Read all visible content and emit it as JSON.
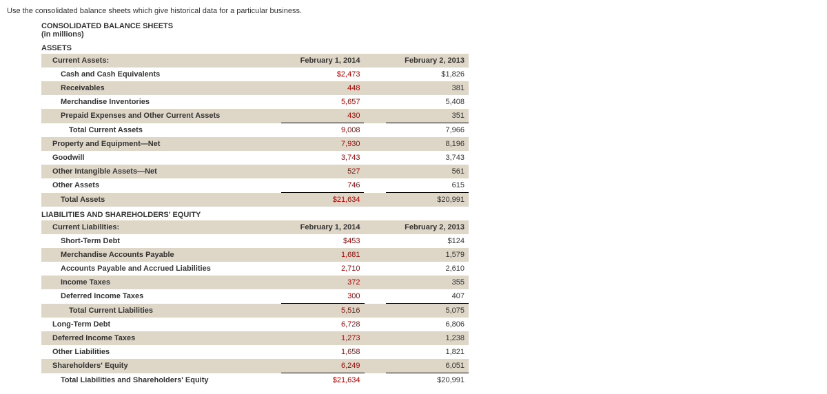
{
  "intro": "Use the consolidated balance sheets which give historical data for a particular business.",
  "title": "CONSOLIDATED BALANCE SHEETS",
  "subtitle": "(in millions)",
  "sections": {
    "assets": {
      "heading": "ASSETS",
      "header": {
        "label": "Current Assets:",
        "c1": "February 1, 2014",
        "c2": "February 2, 2013"
      },
      "rows": [
        {
          "label": "Cash and Cash Equivalents",
          "c1": "$2,473",
          "c2": "$1,826",
          "shade": false
        },
        {
          "label": "Receivables",
          "c1": "448",
          "c2": "381",
          "shade": true
        },
        {
          "label": "Merchandise Inventories",
          "c1": "5,657",
          "c2": "5,408",
          "shade": false
        },
        {
          "label": "Prepaid Expenses and Other Current Assets",
          "c1": "430",
          "c2": "351",
          "shade": true
        }
      ],
      "tca": {
        "label": "Total Current Assets",
        "c1": "9,008",
        "c2": "7,966"
      },
      "rows2": [
        {
          "label": "Property and Equipment—Net",
          "c1": "7,930",
          "c2": "8,196",
          "shade": true
        },
        {
          "label": "Goodwill",
          "c1": "3,743",
          "c2": "3,743",
          "shade": false
        },
        {
          "label": "Other Intangible Assets—Net",
          "c1": "527",
          "c2": "561",
          "shade": true
        },
        {
          "label": "Other Assets",
          "c1": "746",
          "c2": "615",
          "shade": false
        }
      ],
      "total": {
        "label": "Total Assets",
        "c1": "$21,634",
        "c2": "$20,991"
      }
    },
    "liab": {
      "heading": "LIABILITIES AND SHAREHOLDERS' EQUITY",
      "header": {
        "label": "Current Liabilities:",
        "c1": "February 1, 2014",
        "c2": "February 2, 2013"
      },
      "rows": [
        {
          "label": "Short-Term Debt",
          "c1": "$453",
          "c2": "$124",
          "shade": false
        },
        {
          "label": "Merchandise Accounts Payable",
          "c1": "1,681",
          "c2": "1,579",
          "shade": true
        },
        {
          "label": "Accounts Payable and Accrued Liabilities",
          "c1": "2,710",
          "c2": "2,610",
          "shade": false
        },
        {
          "label": "Income Taxes",
          "c1": "372",
          "c2": "355",
          "shade": true
        },
        {
          "label": "Deferred Income Taxes",
          "c1": "300",
          "c2": "407",
          "shade": false
        }
      ],
      "tcl": {
        "label": "Total Current Liabilities",
        "c1": "5,516",
        "c2": "5,075"
      },
      "rows2": [
        {
          "label": "Long-Term Debt",
          "c1": "6,728",
          "c2": "6,806",
          "shade": false
        },
        {
          "label": "Deferred Income Taxes",
          "c1": "1,273",
          "c2": "1,238",
          "shade": true
        },
        {
          "label": "Other Liabilities",
          "c1": "1,658",
          "c2": "1,821",
          "shade": false
        },
        {
          "label": "Shareholders' Equity",
          "c1": "6,249",
          "c2": "6,051",
          "shade": true
        }
      ],
      "total": {
        "label": "Total Liabilities and Shareholders' Equity",
        "c1": "$21,634",
        "c2": "$20,991"
      }
    }
  }
}
